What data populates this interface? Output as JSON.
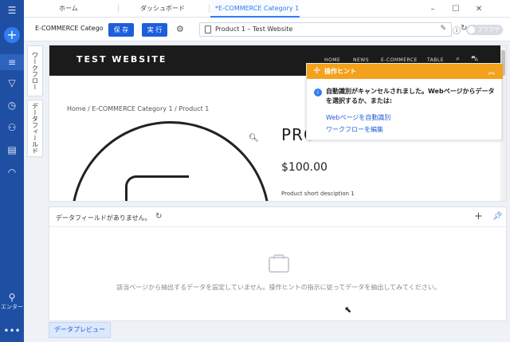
{
  "rail": {
    "user_label": "エンター",
    "more": "•••"
  },
  "tabs": {
    "items": [
      {
        "label": "ホーム"
      },
      {
        "label": "ダッシュボード"
      },
      {
        "label": "*E-COMMERCE Category 1 -"
      }
    ],
    "active_index": 2,
    "window": {
      "minimize": "–",
      "maximize": "☐",
      "close": "✕"
    }
  },
  "toolbar": {
    "task_name": "E-COMMERCE Category",
    "save_label": "保 存",
    "run_label": "実 行",
    "url_text": "Product 1 – Test Website",
    "browser_toggle": "ブラウザ"
  },
  "side_tabs": {
    "workflow": "ワークフロー",
    "data_field": "データフィールド"
  },
  "website": {
    "title": "TEST WEBSITE",
    "nav": [
      "HOME",
      "NEWS",
      "E-COMMERCE",
      "TABLE"
    ],
    "breadcrumb": "Home / E-COMMERCE Category 1 / Product 1",
    "product_title": "PRO",
    "price": "$100.00",
    "short_description": "Product short desciption 1"
  },
  "hint": {
    "title": "操作ヒント",
    "message": "自動識別がキャンセルされました。Webページからデータを選択するか、または:",
    "links": [
      "Webページを自動識別",
      "ワークフローを編集"
    ]
  },
  "data_panel": {
    "title": "データフィールドがありません。",
    "empty_message": "該当ページから抽出するデータを設定していません。操作ヒントの指示に従ってデータを抽出してみてください。"
  },
  "footer": {
    "preview_tab": "データプレビュー"
  },
  "colors": {
    "rail": "#1f4fa3",
    "accent": "#1d5ed9",
    "hint_header": "#f4a11b"
  }
}
